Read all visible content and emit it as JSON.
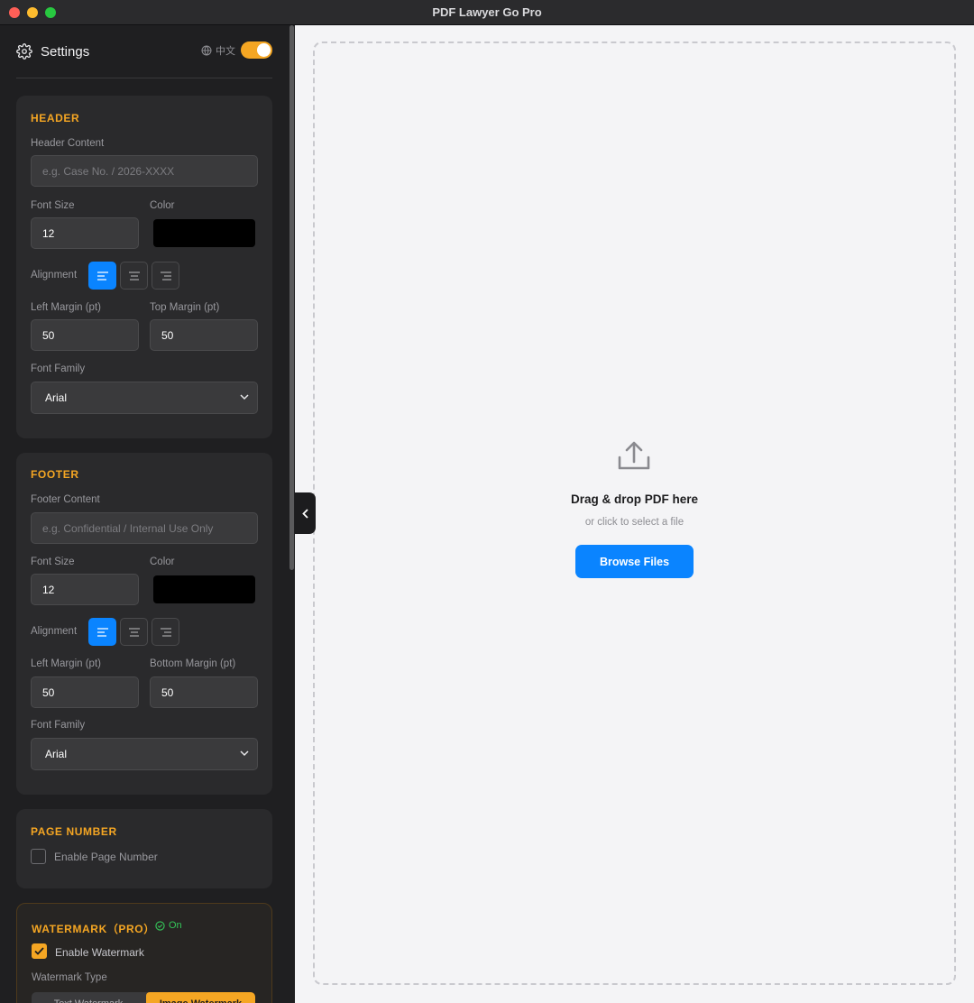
{
  "window": {
    "title": "PDF Lawyer Go Pro"
  },
  "sidebar": {
    "title": "Settings",
    "language_label": "中文",
    "header": {
      "title": "HEADER",
      "content_label": "Header Content",
      "content_placeholder": "e.g. Case No. / 2026-XXXX",
      "font_size_label": "Font Size",
      "font_size_value": "12",
      "color_label": "Color",
      "color_value": "#000000",
      "alignment_label": "Alignment",
      "alignment_selected": "left",
      "margin1_label": "Left Margin (pt)",
      "margin1_value": "50",
      "margin2_label": "Top Margin (pt)",
      "margin2_value": "50",
      "font_family_label": "Font Family",
      "font_family_value": "Arial"
    },
    "footer": {
      "title": "FOOTER",
      "content_label": "Footer Content",
      "content_placeholder": "e.g. Confidential / Internal Use Only",
      "font_size_label": "Font Size",
      "font_size_value": "12",
      "color_label": "Color",
      "color_value": "#000000",
      "alignment_label": "Alignment",
      "alignment_selected": "left",
      "margin1_label": "Left Margin (pt)",
      "margin1_value": "50",
      "margin2_label": "Bottom Margin (pt)",
      "margin2_value": "50",
      "font_family_label": "Font Family",
      "font_family_value": "Arial"
    },
    "page_number": {
      "title": "PAGE NUMBER",
      "enable_label": "Enable Page Number",
      "enabled": false
    },
    "watermark": {
      "title": "WATERMARK（PRO）",
      "status": "On",
      "enable_label": "Enable Watermark",
      "enabled": true,
      "type_label": "Watermark Type",
      "type_options": [
        "Text Watermark",
        "Image Watermark"
      ],
      "type_selected": "Image Watermark"
    }
  },
  "dropzone": {
    "title": "Drag & drop PDF here",
    "subtitle": "or click to select a file",
    "button_label": "Browse Files"
  },
  "colors": {
    "accent": "#f5a623",
    "primary": "#0a84ff",
    "success": "#34c759"
  },
  "icons": [
    "gear-icon",
    "globe-icon",
    "align-left-icon",
    "align-center-icon",
    "align-right-icon",
    "chevron-down-icon",
    "check-circle-icon",
    "checkmark-icon",
    "upload-icon",
    "chevron-left-icon"
  ]
}
